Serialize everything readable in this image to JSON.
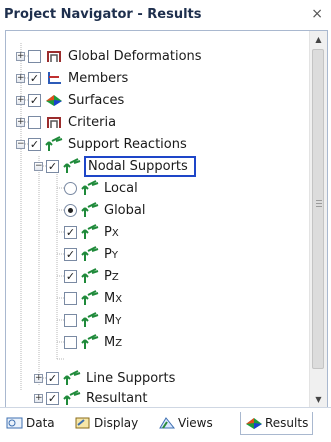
{
  "window": {
    "title": "Project Navigator - Results",
    "close_glyph": "×"
  },
  "tree": {
    "global_deformations": "Global Deformations",
    "members": "Members",
    "surfaces": "Surfaces",
    "criteria": "Criteria",
    "support_reactions": "Support Reactions",
    "nodal_supports": "Nodal Supports",
    "local": "Local",
    "global": "Global",
    "px": "P",
    "px_sub": "X",
    "py": "P",
    "py_sub": "Y",
    "pz": "P",
    "pz_sub": "Z",
    "mx": "M",
    "mx_sub": "X",
    "my": "M",
    "my_sub": "Y",
    "mz": "M",
    "mz_sub": "Z",
    "line_supports": "Line Supports",
    "resultant": "Resultant"
  },
  "tabs": {
    "data": "Data",
    "display": "Display",
    "views": "Views",
    "results": "Results"
  },
  "colors": {
    "selection_border": "#1e46c8",
    "title": "#1e2f4d",
    "support_icon": "#1f8a3a"
  }
}
